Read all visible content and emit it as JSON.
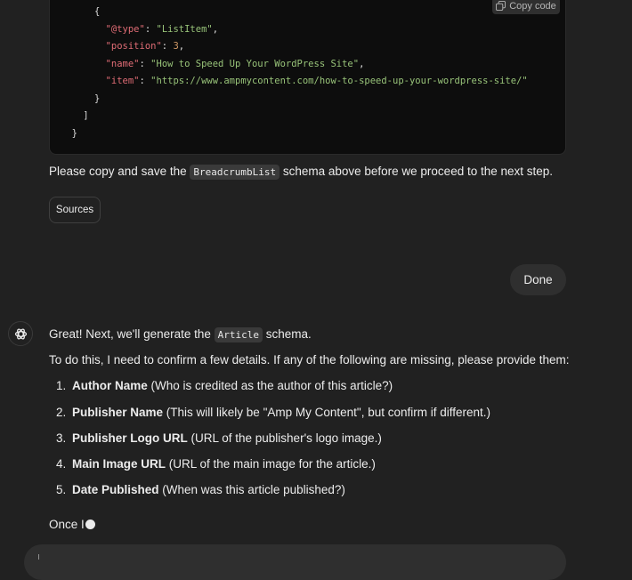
{
  "code_block": {
    "copy_label": "Copy code",
    "lines": [
      {
        "indent": "      ",
        "parts": [
          {
            "t": "{",
            "c": "p"
          }
        ]
      },
      {
        "indent": "        ",
        "parts": [
          {
            "t": "\"@type\"",
            "c": "key"
          },
          {
            "t": ": ",
            "c": "p"
          },
          {
            "t": "\"ListItem\"",
            "c": "str"
          },
          {
            "t": ",",
            "c": "p"
          }
        ]
      },
      {
        "indent": "        ",
        "parts": [
          {
            "t": "\"position\"",
            "c": "key"
          },
          {
            "t": ": ",
            "c": "p"
          },
          {
            "t": "3",
            "c": "num"
          },
          {
            "t": ",",
            "c": "p"
          }
        ]
      },
      {
        "indent": "        ",
        "parts": [
          {
            "t": "\"name\"",
            "c": "key"
          },
          {
            "t": ": ",
            "c": "p"
          },
          {
            "t": "\"How to Speed Up Your WordPress Site\"",
            "c": "str"
          },
          {
            "t": ",",
            "c": "p"
          }
        ]
      },
      {
        "indent": "        ",
        "parts": [
          {
            "t": "\"item\"",
            "c": "key"
          },
          {
            "t": ": ",
            "c": "p"
          },
          {
            "t": "\"https://www.ampmycontent.com/how-to-speed-up-your-wordpress-site/\"",
            "c": "str"
          }
        ]
      },
      {
        "indent": "      ",
        "parts": [
          {
            "t": "}",
            "c": "p"
          }
        ]
      },
      {
        "indent": "    ",
        "parts": [
          {
            "t": "]",
            "c": "p"
          }
        ]
      },
      {
        "indent": "  ",
        "parts": [
          {
            "t": "}",
            "c": "p"
          }
        ]
      }
    ]
  },
  "copy_instruction": {
    "before": "Please copy and save the ",
    "code": "BreadcrumbList",
    "after": " schema above before we proceed to the next step."
  },
  "sources_label": "Sources",
  "user_message": "Done",
  "assistant": {
    "intro_before": "Great! Next, we'll generate the ",
    "intro_code": "Article",
    "intro_after": " schema.",
    "confirm_text": "To do this, I need to confirm a few details. If any of the following are missing, please provide them:",
    "items": [
      {
        "num": "1.",
        "bold": "Author Name",
        "rest": " (Who is credited as the author of this article?)"
      },
      {
        "num": "2.",
        "bold": "Publisher Name",
        "rest": " (This will likely be \"Amp My Content\", but confirm if different.)"
      },
      {
        "num": "3.",
        "bold": "Publisher Logo URL",
        "rest": " (URL of the publisher's logo image.)"
      },
      {
        "num": "4.",
        "bold": "Main Image URL",
        "rest": " (URL of the main image for the article.)"
      },
      {
        "num": "5.",
        "bold": "Date Published",
        "rest": " (When was this article published?)"
      }
    ],
    "streaming_text": "Once I"
  },
  "colors": {
    "background": "#212121",
    "code_bg": "#0d0d0d",
    "json_key": "#e06c75",
    "json_string": "#98c379",
    "json_number": "#d19a66"
  }
}
